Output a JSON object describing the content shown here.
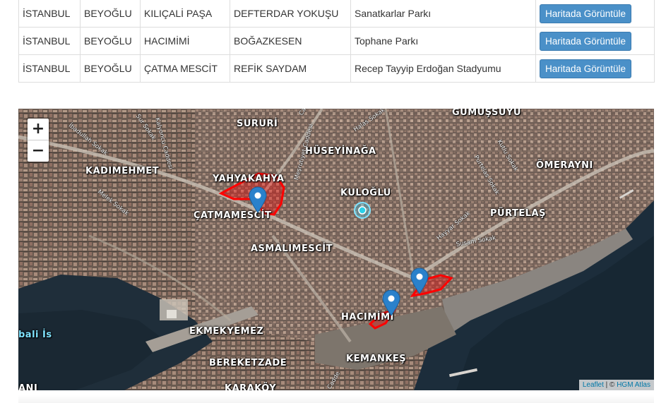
{
  "table": {
    "rows": [
      {
        "il": "İSTANBUL",
        "ilce": "BEYOĞLU",
        "mahalle": "KILIÇALİ PAŞA",
        "sokak": "DEFTERDAR YOKUŞU",
        "park": "Sanatkarlar Parkı",
        "button": "Haritada Görüntüle"
      },
      {
        "il": "İSTANBUL",
        "ilce": "BEYOĞLU",
        "mahalle": "HACIMİMİ",
        "sokak": "BOĞAZKESEN",
        "park": "Tophane Parkı",
        "button": "Haritada Görüntüle"
      },
      {
        "il": "İSTANBUL",
        "ilce": "BEYOĞLU",
        "mahalle": "ÇATMA MESCİT",
        "sokak": "REFİK SAYDAM",
        "park": "Recep Tayyip Erdoğan Stadyumu",
        "button": "Haritada Görüntüle"
      }
    ]
  },
  "map": {
    "zoom_in": "+",
    "zoom_out": "−",
    "attribution": {
      "leaflet": "Leaflet",
      "sep": " | © ",
      "hgm": "HGM Atlas"
    },
    "neighborhoods": [
      "SURURİ",
      "GÜMÜŞSUYU",
      "HÜSEYİNAĞA",
      "KADIMEHMET",
      "YAHYAKAHYA",
      "KULOĞLU",
      "ÖMERAYNI",
      "ÇATMAMESCİT",
      "PÜRTELAŞ",
      "ASMALIMESCİT",
      "HACIMİMİ",
      "EKMEKYEMEZ",
      "KEMANKEŞ",
      "BEREKETZADE",
      "KARAKÖY",
      "ANI",
      "bali İs"
    ],
    "streets": [
      "İbadullah Sokak",
      "Sur Sokak",
      "Kalyoncu Caddesi",
      "Cadde",
      "Halas Sokak",
      "Meşrutiyet Caddesi",
      "Purtelas Sokak",
      "Kutlu Sokak",
      "Melek Sokak",
      "Hayyar Sokak",
      "Susam Sokak",
      "Cadde"
    ],
    "markers_count": 3
  }
}
